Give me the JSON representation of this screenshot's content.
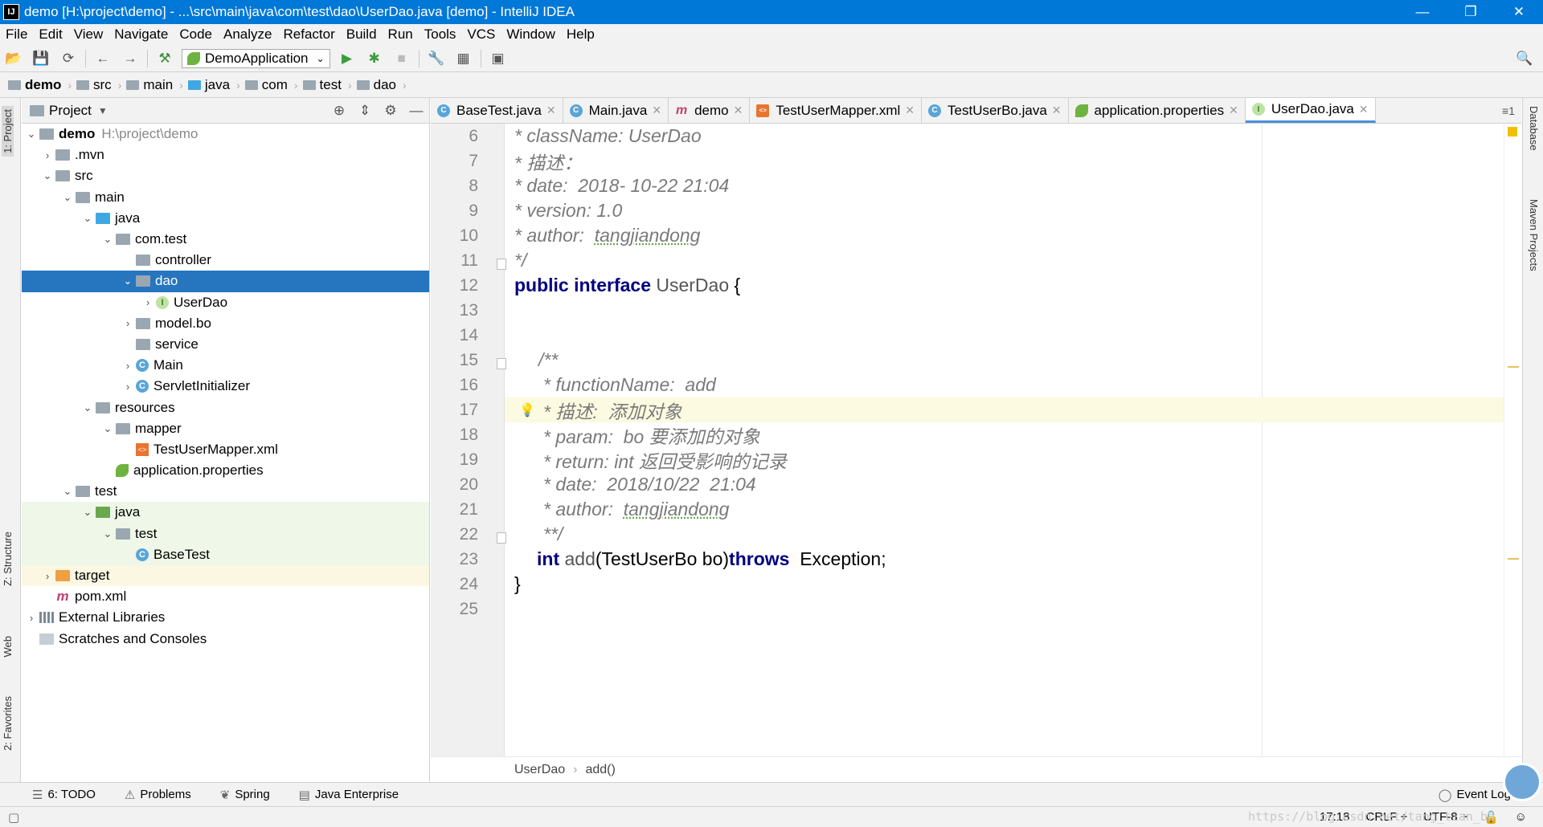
{
  "window": {
    "title": "demo [H:\\project\\demo] - ...\\src\\main\\java\\com\\test\\dao\\UserDao.java [demo] - IntelliJ IDEA",
    "minimize": "—",
    "maximize": "❐",
    "close": "✕"
  },
  "menu": [
    "File",
    "Edit",
    "View",
    "Navigate",
    "Code",
    "Analyze",
    "Refactor",
    "Build",
    "Run",
    "Tools",
    "VCS",
    "Window",
    "Help"
  ],
  "toolbar": {
    "run_config": "DemoApplication"
  },
  "navbar": [
    "demo",
    "src",
    "main",
    "java",
    "com",
    "test",
    "dao"
  ],
  "left_tabs": {
    "project": "1: Project",
    "structure": "Z: Structure",
    "web": "Web",
    "favorites": "2: Favorites"
  },
  "right_tabs": {
    "database": "Database",
    "maven": "Maven Projects"
  },
  "project_panel": {
    "title": "Project",
    "tree": [
      {
        "label": "demo",
        "path": "H:\\project\\demo"
      },
      {
        "label": ".mvn"
      },
      {
        "label": "src"
      },
      {
        "label": "main"
      },
      {
        "label": "java"
      },
      {
        "label": "com.test"
      },
      {
        "label": "controller"
      },
      {
        "label": "dao"
      },
      {
        "label": "UserDao"
      },
      {
        "label": "model.bo"
      },
      {
        "label": "service"
      },
      {
        "label": "Main"
      },
      {
        "label": "ServletInitializer"
      },
      {
        "label": "resources"
      },
      {
        "label": "mapper"
      },
      {
        "label": "TestUserMapper.xml"
      },
      {
        "label": "application.properties"
      },
      {
        "label": "test"
      },
      {
        "label": "java"
      },
      {
        "label": "test"
      },
      {
        "label": "BaseTest"
      },
      {
        "label": "target"
      },
      {
        "label": "pom.xml"
      },
      {
        "label": "External Libraries"
      },
      {
        "label": "Scratches and Consoles"
      }
    ]
  },
  "tabs": [
    "BaseTest.java",
    "Main.java",
    "demo",
    "TestUserMapper.xml",
    "TestUserBo.java",
    "application.properties",
    "UserDao.java"
  ],
  "line_numbers": [
    "6",
    "7",
    "8",
    "9",
    "10",
    "11",
    "12",
    "13",
    "14",
    "15",
    "16",
    "17",
    "18",
    "19",
    "20",
    "21",
    "22",
    "23",
    "24",
    "25"
  ],
  "code": {
    "l6": "* className: UserDao",
    "l7": "* 描述：",
    "l8": "* date:  2018- 10-22 21:04",
    "l9": "* version: 1.0",
    "l10a": "* author:  ",
    "l10b": "tangjiandong",
    "l11": "*/",
    "l12a": "public interface ",
    "l12b": "UserDao",
    "l12c": " {",
    "l15": "/**",
    "l16": "* functionName:  add",
    "l17": "* 描述:  添加对象",
    "l18": "* param:  bo 要添加的对象",
    "l19": "* return: int 返回受影响的记录",
    "l20": "* date:  2018/10/22  21:04",
    "l21a": "* author:  ",
    "l21b": "tangjiandong",
    "l22": "**/",
    "l23a": "int ",
    "l23b": "add",
    "l23c": "(TestUserBo bo)",
    "l23d": "throws",
    "l23e": "  Exception;",
    "l24": "}"
  },
  "editor_breadcrumbs": {
    "cls": "UserDao",
    "method": "add()"
  },
  "bottom_tools": [
    "6: TODO",
    "Problems",
    "Spring",
    "Java Enterprise"
  ],
  "event_log": "Event Log",
  "status": {
    "position": "17:18",
    "line_sep": "CRLF ÷",
    "encoding": "UTF-8 ÷"
  },
  "watermark": "https://blog.csdn.net/tang_tian_ba"
}
